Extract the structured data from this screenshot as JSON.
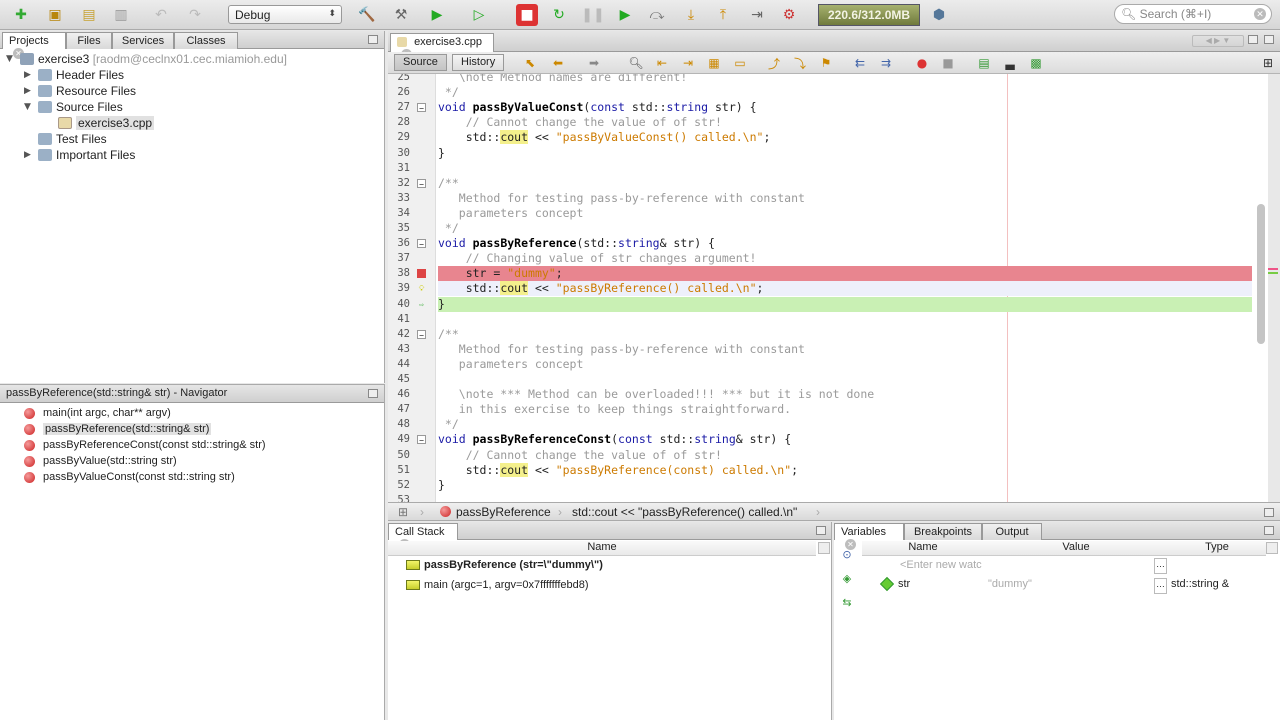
{
  "toolbar": {
    "config_value": "Debug",
    "memory": "220.6/312.0MB",
    "search_placeholder": "Search (⌘+I)"
  },
  "projects_panel": {
    "tabs": [
      "Projects",
      "Files",
      "Services",
      "Classes"
    ],
    "tree": [
      {
        "label": "exercise3",
        "detail": "[raodm@ceclnx01.cec.miamioh.edu]"
      },
      {
        "label": "Header Files"
      },
      {
        "label": "Resource Files"
      },
      {
        "label": "Source Files"
      },
      {
        "label": "exercise3.cpp"
      },
      {
        "label": "Test Files"
      },
      {
        "label": "Important Files"
      }
    ]
  },
  "navigator": {
    "title": "passByReference(std::string& str) - Navigator",
    "items": [
      "main(int argc, char** argv)",
      "passByReference(std::string& str)",
      "passByReferenceConst(const std::string& str)",
      "passByValue(std::string str)",
      "passByValueConst(const std::string str)"
    ]
  },
  "editor": {
    "tab": "exercise3.cpp",
    "source_label": "Source",
    "history_label": "History",
    "lines": [
      {
        "n": "25",
        "parts": [
          [
            "cm",
            "   \\note Method names are different!"
          ]
        ]
      },
      {
        "n": "26",
        "parts": [
          [
            "cm",
            " */"
          ]
        ]
      },
      {
        "n": "27",
        "parts": [
          [
            "kw",
            "void "
          ],
          [
            "fn",
            "passByValueConst"
          ],
          [
            "",
            "("
          ],
          [
            "kw",
            "const "
          ],
          [
            "",
            "std::"
          ],
          [
            "ty",
            "string "
          ],
          [
            "",
            "str) {"
          ]
        ]
      },
      {
        "n": "28",
        "parts": [
          [
            "cm",
            "    // Cannot change the value of of str!"
          ]
        ]
      },
      {
        "n": "29",
        "parts": [
          [
            "",
            "    std::"
          ],
          [
            "hl",
            "cout"
          ],
          [
            "",
            " << "
          ],
          [
            "str",
            "\"passByValueConst() called.\\n\""
          ],
          [
            "",
            ";"
          ]
        ]
      },
      {
        "n": "30",
        "parts": [
          [
            "",
            "}"
          ]
        ]
      },
      {
        "n": "31",
        "parts": [
          [
            "",
            ""
          ]
        ]
      },
      {
        "n": "32",
        "parts": [
          [
            "cm",
            "/**"
          ]
        ]
      },
      {
        "n": "33",
        "parts": [
          [
            "cm",
            "   Method for testing pass-by-reference with constant"
          ]
        ]
      },
      {
        "n": "34",
        "parts": [
          [
            "cm",
            "   parameters concept"
          ]
        ]
      },
      {
        "n": "35",
        "parts": [
          [
            "cm",
            " */"
          ]
        ]
      },
      {
        "n": "36",
        "parts": [
          [
            "kw",
            "void "
          ],
          [
            "fn",
            "passByReference"
          ],
          [
            "",
            "(std::"
          ],
          [
            "ty",
            "string"
          ],
          [
            "",
            "& str) {"
          ]
        ]
      },
      {
        "n": "37",
        "parts": [
          [
            "cm",
            "    // Changing value of str changes argument!"
          ]
        ]
      },
      {
        "n": "38",
        "parts": [
          [
            "",
            "    str = "
          ],
          [
            "str",
            "\"dummy\""
          ],
          [
            "",
            ";"
          ]
        ]
      },
      {
        "n": "39",
        "parts": [
          [
            "",
            "    std::"
          ],
          [
            "hl",
            "cout"
          ],
          [
            "",
            " << "
          ],
          [
            "str",
            "\"passByReference() called.\\n\""
          ],
          [
            "",
            ";"
          ]
        ]
      },
      {
        "n": "40",
        "parts": [
          [
            "",
            "}"
          ]
        ]
      },
      {
        "n": "41",
        "parts": [
          [
            "",
            ""
          ]
        ]
      },
      {
        "n": "42",
        "parts": [
          [
            "cm",
            "/**"
          ]
        ]
      },
      {
        "n": "43",
        "parts": [
          [
            "cm",
            "   Method for testing pass-by-reference with constant"
          ]
        ]
      },
      {
        "n": "44",
        "parts": [
          [
            "cm",
            "   parameters concept"
          ]
        ]
      },
      {
        "n": "45",
        "parts": [
          [
            "",
            ""
          ]
        ]
      },
      {
        "n": "46",
        "parts": [
          [
            "cm",
            "   \\note *** Method can be overloaded!!! *** but it is not done"
          ]
        ]
      },
      {
        "n": "47",
        "parts": [
          [
            "cm",
            "   in this exercise to keep things straightforward."
          ]
        ]
      },
      {
        "n": "48",
        "parts": [
          [
            "cm",
            " */"
          ]
        ]
      },
      {
        "n": "49",
        "parts": [
          [
            "kw",
            "void "
          ],
          [
            "fn",
            "passByReferenceConst"
          ],
          [
            "",
            "("
          ],
          [
            "kw",
            "const "
          ],
          [
            "",
            "std::"
          ],
          [
            "ty",
            "string"
          ],
          [
            "",
            "& str) {"
          ]
        ]
      },
      {
        "n": "50",
        "parts": [
          [
            "cm",
            "    // Cannot change the value of of str!"
          ]
        ]
      },
      {
        "n": "51",
        "parts": [
          [
            "",
            "    std::"
          ],
          [
            "hl",
            "cout"
          ],
          [
            "",
            " << "
          ],
          [
            "str",
            "\"passByReference(const) called.\\n\""
          ],
          [
            "",
            ";"
          ]
        ]
      },
      {
        "n": "52",
        "parts": [
          [
            "",
            "}"
          ]
        ]
      },
      {
        "n": "53",
        "parts": [
          [
            "",
            ""
          ]
        ]
      }
    ]
  },
  "breadcrumb": {
    "function": "passByReference",
    "statement": "std::cout << \"passByReference() called.\\n\""
  },
  "callstack": {
    "tab": "Call Stack",
    "column": "Name",
    "frames": [
      "passByReference (str=\\\"dummy\\\")",
      "main (argc=1, argv=0x7fffffffebd8)"
    ]
  },
  "variables": {
    "tabs": [
      "Variables",
      "Breakpoints",
      "Output"
    ],
    "columns": [
      "Name",
      "Value",
      "Type"
    ],
    "new_watch": "<Enter new watc",
    "rows": [
      {
        "name": "str",
        "value": "\"dummy\"",
        "type": "std::string &"
      }
    ]
  },
  "colors": {
    "breakpoint": "#e8858f",
    "current_line": "#c9f0b4",
    "keyword": "#1a1aa6",
    "string": "#cc7a00"
  }
}
